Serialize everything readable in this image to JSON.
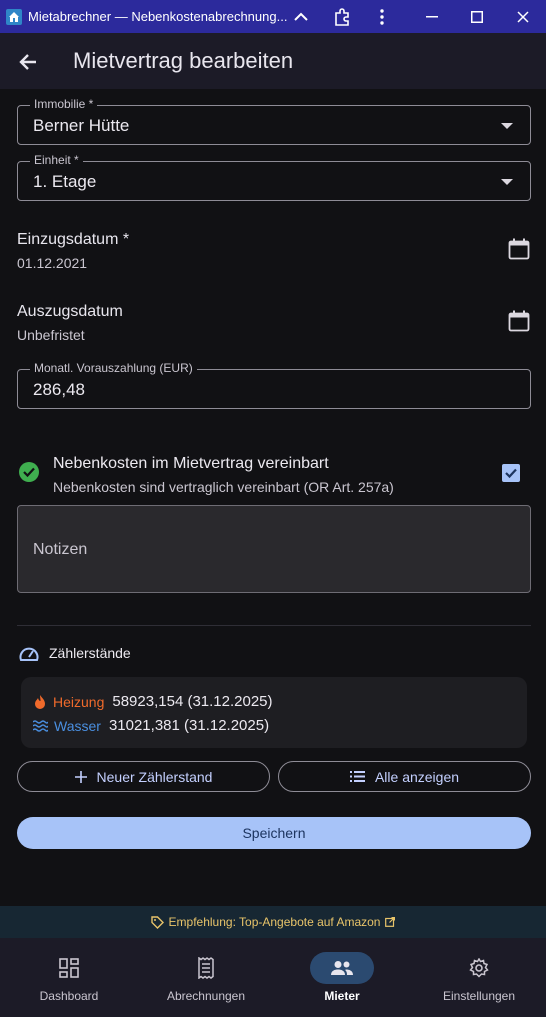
{
  "window": {
    "title": "Mietabrechner — Nebenkostenabrechnung...",
    "titlebar_color": "#2c2a9c",
    "controls": [
      "chevron-up-icon",
      "extension-icon",
      "more-vert-icon",
      "minimize-icon",
      "maximize-icon",
      "close-icon"
    ]
  },
  "appbar": {
    "title": "Mietvertrag bearbeiten"
  },
  "form": {
    "immobilie": {
      "label": "Immobilie *",
      "value": "Berner Hütte"
    },
    "einheit": {
      "label": "Einheit *",
      "value": "1. Etage"
    },
    "einzugsdatum": {
      "label": "Einzugsdatum *",
      "value": "01.12.2021"
    },
    "auszugsdatum": {
      "label": "Auszugsdatum",
      "value": "Unbefristet"
    },
    "vorauszahlung": {
      "label": "Monatl. Vorauszahlung (EUR)",
      "value": "286,48"
    },
    "nebenkosten": {
      "title": "Nebenkosten im Mietvertrag vereinbart",
      "subtitle": "Nebenkosten sind vertraglich vereinbart (OR Art. 257a)",
      "checked": true
    },
    "notizen": {
      "placeholder": "Notizen"
    }
  },
  "meters": {
    "heading": "Zählerstände",
    "items": [
      {
        "name": "Heizung",
        "value": "58923,154 (31.12.2025)",
        "color": "#f06a2b",
        "icon": "flame-icon"
      },
      {
        "name": "Wasser",
        "value": "31021,381 (31.12.2025)",
        "color": "#4a8fe0",
        "icon": "water-waves-icon"
      }
    ],
    "new_button": "Neuer Zählerstand",
    "all_button": "Alle anzeigen"
  },
  "save_button": "Speichern",
  "promo": {
    "text": "Empfehlung: Top-Angebote auf Amazon"
  },
  "nav": [
    {
      "label": "Dashboard",
      "icon": "dashboard-icon",
      "active": false
    },
    {
      "label": "Abrechnungen",
      "icon": "receipt-icon",
      "active": false
    },
    {
      "label": "Mieter",
      "icon": "people-icon",
      "active": true
    },
    {
      "label": "Einstellungen",
      "icon": "gear-icon",
      "active": false
    }
  ],
  "colors": {
    "accent": "#a7c3f8",
    "check": "#3fae4f",
    "checkbox": "#a7c3f8",
    "promo_text": "#e8c46a"
  }
}
